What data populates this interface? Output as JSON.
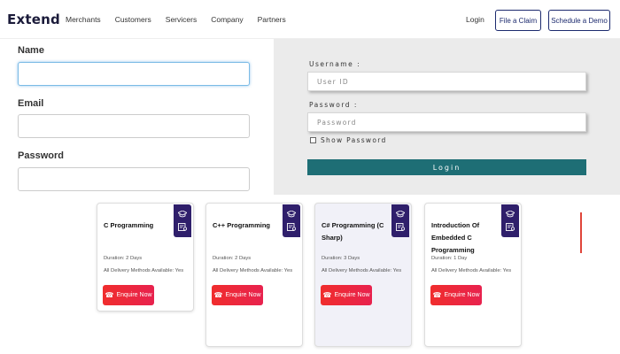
{
  "header": {
    "logo": "Extend",
    "nav": [
      "Merchants",
      "Customers",
      "Servicers",
      "Company",
      "Partners"
    ],
    "login": "Login",
    "file_claim": "File a Claim",
    "schedule_demo": "Schedule a Demo"
  },
  "signup_form": {
    "name_label": "Name",
    "name_value": "",
    "email_label": "Email",
    "email_value": "",
    "password_label": "Password",
    "password_value": ""
  },
  "login_panel": {
    "username_label": "Username :",
    "username_placeholder": "User ID",
    "password_label": "Password :",
    "password_placeholder": "Password",
    "show_password_label": "Show Password",
    "show_password_checked": false,
    "login_button": "Login"
  },
  "courses": [
    {
      "title": "C Programming",
      "duration": "Duration: 2 Days",
      "delivery": "All Delivery Methods Available: Yes",
      "cta": "Enquire Now"
    },
    {
      "title": "C++ Programming",
      "duration": "Duration: 2 Days",
      "delivery": "All Delivery Methods Available: Yes",
      "cta": "Enquire Now"
    },
    {
      "title": "C# Programming (C Sharp)",
      "duration": "Duration: 3 Days",
      "delivery": "All Delivery Methods Available: Yes",
      "cta": "Enquire Now"
    },
    {
      "title": "Introduction Of Embedded C Programming",
      "duration": "Duration: 1 Day",
      "delivery": "All Delivery Methods Available: Yes",
      "cta": "Enquire Now"
    }
  ],
  "colors": {
    "brand_navy": "#1c2a6e",
    "login_button": "#1e6e75",
    "card_badge": "#2f1f6b",
    "enquire_button": "#f02d2d",
    "panel_bg": "#ebebeb"
  },
  "icons": {
    "card_badge_top": "graduation-cap-icon",
    "card_badge_bottom": "certificate-icon",
    "enquire": "phone-icon"
  }
}
